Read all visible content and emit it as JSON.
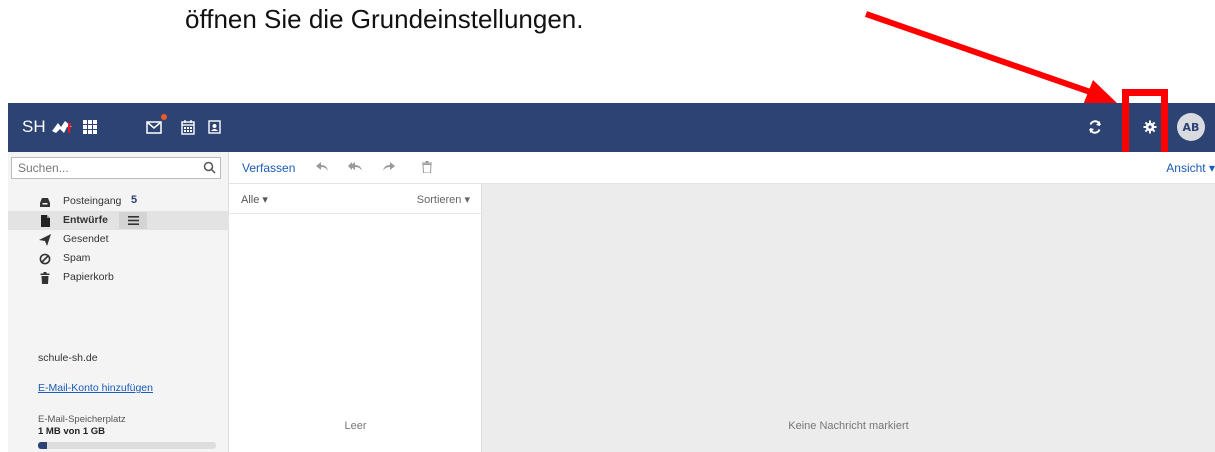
{
  "instruction": "öffnen Sie die Grundeinstellungen.",
  "topbar": {
    "brand": "SH",
    "icons": [
      "apps-grid-icon",
      "mail-icon",
      "calendar-icon",
      "contacts-icon",
      "refresh-icon",
      "gear-icon"
    ],
    "avatar": "AB",
    "color": "#2c4373",
    "notification_color": "#f05a28"
  },
  "highlight": {
    "color": "#ff0000"
  },
  "search": {
    "placeholder": "Suchen..."
  },
  "folders": [
    {
      "label": "Posteingang",
      "icon": "inbox-icon",
      "count": "5"
    },
    {
      "label": "Entwürfe",
      "icon": "draft-icon",
      "active": true
    },
    {
      "label": "Gesendet",
      "icon": "sent-icon"
    },
    {
      "label": "Spam",
      "icon": "spam-icon"
    },
    {
      "label": "Papierkorb",
      "icon": "trash-icon"
    }
  ],
  "account": "schule-sh.de",
  "add_account": "E-Mail-Konto hinzufügen",
  "storage": {
    "label": "E-Mail-Speicherplatz",
    "value": "1 MB von 1 GB",
    "fill_percent": 5
  },
  "toolbar": {
    "compose": "Verfassen",
    "view": "Ansicht ▾"
  },
  "list": {
    "filter": "Alle ▾",
    "sort": "Sortieren ▾",
    "empty": "Leer"
  },
  "detail": {
    "empty": "Keine Nachricht markiert"
  }
}
